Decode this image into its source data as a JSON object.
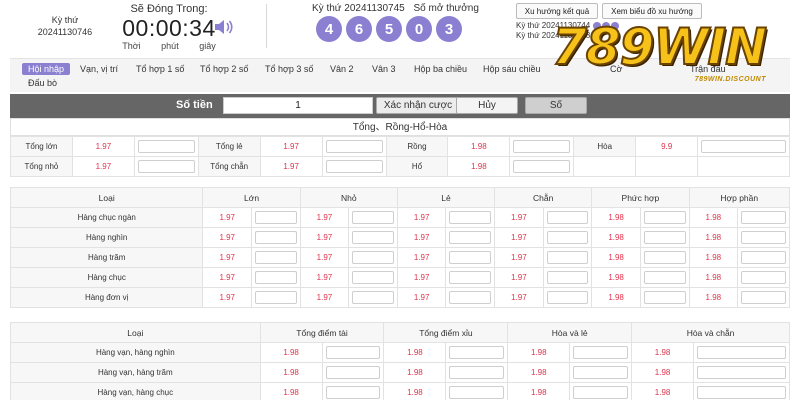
{
  "header": {
    "ky_label": "Kỳ thứ",
    "ky_value": "20241130746",
    "close_title": "Sẽ Đóng Trong:",
    "clock": "00:00:34",
    "units": [
      "Thời",
      "phút",
      "giây"
    ],
    "draw_label": "Kỳ thứ 20241130745",
    "draw_result_label": "Số mở thưởng",
    "balls": [
      "4",
      "6",
      "5",
      "0",
      "3"
    ],
    "trend_button": "Xu hướng kết quả",
    "chart_button": "Xem biểu đồ xu hướng",
    "history": [
      "Kỳ thứ 20241130744",
      "Kỳ thứ 20241130743"
    ]
  },
  "logo": {
    "main": "789WIN",
    "sub": "789WIN.DISCOUNT"
  },
  "tabs": [
    "Hội nhập",
    "Vạn, vị trí",
    "Tổ hợp 1 số",
    "Tổ hợp 2 số",
    "Tổ hợp 3 số",
    "Vân 2",
    "Vân 3",
    "Hộp ba chiều",
    "Hộp sáu chiều",
    "Cờ",
    "Trận đấu",
    "Đấu bò"
  ],
  "amount": {
    "label": "Số tiền",
    "value": "1",
    "confirm": "Xác nhận cược",
    "cancel": "Hủy",
    "number": "Số"
  },
  "section_title": "Tổng、Rồng-Hổ-Hòa",
  "totals": {
    "row1": [
      {
        "label": "Tổng lớn",
        "odds": "1.97"
      },
      {
        "label": "Tổng lẻ",
        "odds": "1.97"
      },
      {
        "label": "Rồng",
        "odds": "1.98"
      },
      {
        "label": "Hòa",
        "odds": "9.9"
      }
    ],
    "row2": [
      {
        "label": "Tổng nhỏ",
        "odds": "1.97"
      },
      {
        "label": "Tổng chẵn",
        "odds": "1.97"
      },
      {
        "label": "Hổ",
        "odds": "1.98"
      }
    ]
  },
  "positions": {
    "headers": [
      "Loại",
      "Lớn",
      "Nhỏ",
      "Lẻ",
      "Chẵn",
      "Phức hợp",
      "Hợp phần"
    ],
    "rows": [
      {
        "label": "Hàng chục ngàn",
        "odds": [
          "1.97",
          "1.97",
          "1.97",
          "1.97",
          "1.98",
          "1.98"
        ]
      },
      {
        "label": "Hàng nghìn",
        "odds": [
          "1.97",
          "1.97",
          "1.97",
          "1.97",
          "1.98",
          "1.98"
        ]
      },
      {
        "label": "Hàng trăm",
        "odds": [
          "1.97",
          "1.97",
          "1.97",
          "1.97",
          "1.98",
          "1.98"
        ]
      },
      {
        "label": "Hàng chục",
        "odds": [
          "1.97",
          "1.97",
          "1.97",
          "1.97",
          "1.98",
          "1.98"
        ]
      },
      {
        "label": "Hàng đơn vị",
        "odds": [
          "1.97",
          "1.97",
          "1.97",
          "1.97",
          "1.98",
          "1.98"
        ]
      }
    ]
  },
  "combos": {
    "headers": [
      "Loại",
      "Tổng điểm tài",
      "Tổng điểm xỉu",
      "Hòa và lẻ",
      "Hòa và chẵn"
    ],
    "rows": [
      {
        "label": "Hàng vạn, hàng nghìn",
        "odds": [
          "1.98",
          "1.98",
          "1.98",
          "1.98"
        ]
      },
      {
        "label": "Hàng vạn, hàng trăm",
        "odds": [
          "1.98",
          "1.98",
          "1.98",
          "1.98"
        ]
      },
      {
        "label": "Hàng vạn, hàng chục",
        "odds": [
          "1.98",
          "1.98",
          "1.98",
          "1.98"
        ]
      }
    ]
  },
  "colors": {
    "accent": "#8a7fd0",
    "odds": "#e0334c",
    "amount_bar": "#666666",
    "logo": "#f6c21a"
  }
}
